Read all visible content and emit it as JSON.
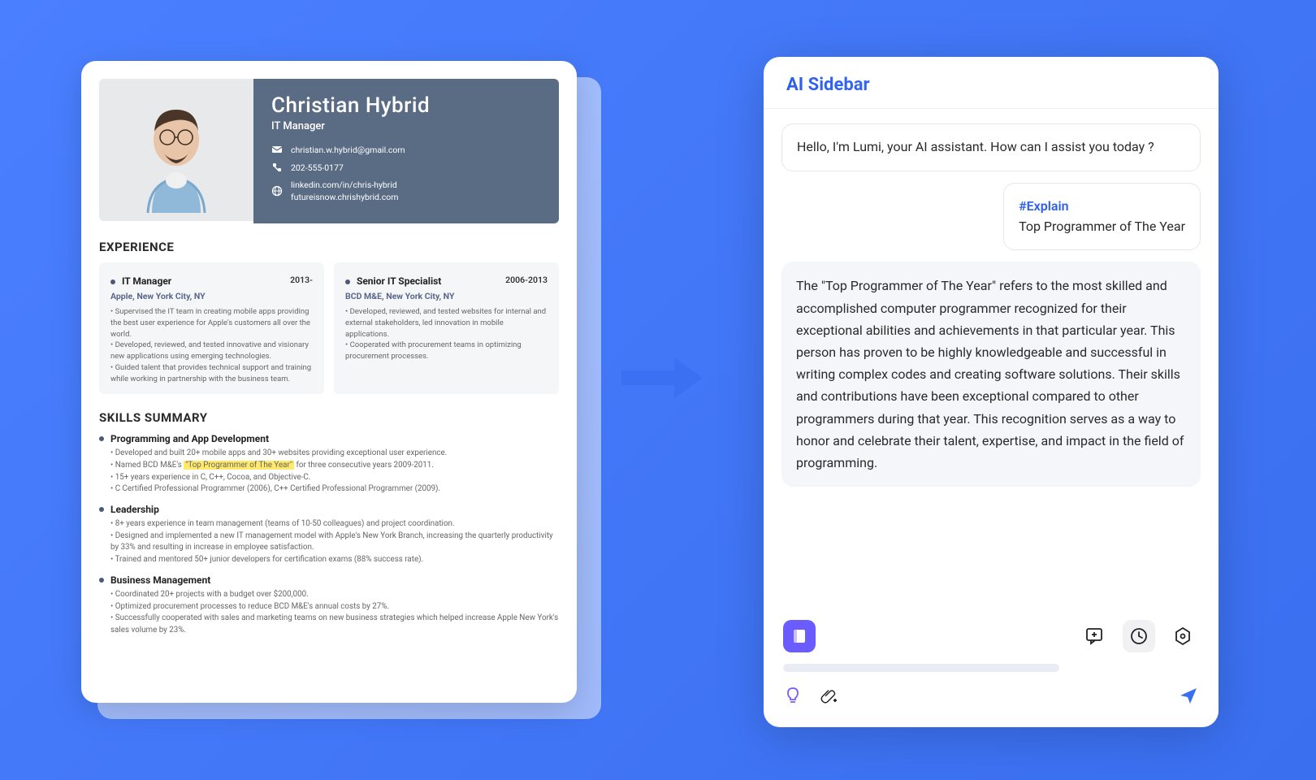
{
  "resume": {
    "name": "Christian Hybrid",
    "title": "IT Manager",
    "email": "christian.w.hybrid@gmail.com",
    "phone": "202-555-0177",
    "linkedin": "linkedin.com/in/chris-hybrid",
    "website": "futureisnow.chrishybrid.com",
    "experience_heading": "EXPERIENCE",
    "skills_heading": "SKILLS SUMMARY",
    "exp1": {
      "role": "IT Manager",
      "period": "2013-",
      "company": "Apple, New York City, NY",
      "b1": "Supervised the IT team in creating mobile apps providing the best user experience for Apple's customers all over the world.",
      "b2": "Developed, reviewed, and tested innovative and visionary new applications using emerging technologies.",
      "b3": "Guided talent that provides technical support and training while working in partnership with the business team."
    },
    "exp2": {
      "role": "Senior IT Specialist",
      "period": "2006-2013",
      "company": "BCD M&E, New York City, NY",
      "b1": "Developed, reviewed, and tested websites for internal and external stakeholders, led innovation in mobile applications.",
      "b2": "Cooperated with procurement teams in optimizing procurement processes."
    },
    "skills": {
      "s1_title": "Programming and App Development",
      "s1_b1": "Developed and built 20+ mobile apps and 30+ websites providing exceptional user experience.",
      "s1_b2a": "Named BCD M&E's ",
      "s1_b2_hl": "\"Top Programmer of The Year\"",
      "s1_b2b": " for three consecutive years 2009-2011.",
      "s1_b3": "15+ years experience in C, C++, Cocoa, and Objective-C.",
      "s1_b4": "C Certified Professional Programmer (2006), C++ Certified Professional Programmer (2009).",
      "s2_title": "Leadership",
      "s2_b1": "8+ years experience in team management (teams of 10-50 colleagues) and project coordination.",
      "s2_b2": "Designed and implemented a new IT management model with Apple's New York Branch, increasing the quarterly productivity by 33% and resulting in increase in employee satisfaction.",
      "s2_b3": "Trained and mentored 50+ junior developers for certification exams (88% success rate).",
      "s3_title": "Business Management",
      "s3_b1": "Coordinated 20+ projects with a budget over $200,000.",
      "s3_b2": "Optimized procurement processes to reduce BCD M&E's annual costs by 27%.",
      "s3_b3": "Successfully cooperated with sales and marketing teams on new business strategies which helped increase Apple New York's sales volume by 23%."
    }
  },
  "sidebar": {
    "title": "AI Sidebar",
    "greeting": "Hello, I'm Lumi, your AI assistant. How can I assist you today ?",
    "user_tag": "#Explain",
    "user_text": "Top Programmer of The Year",
    "assistant": "The \"Top Programmer of The Year\" refers to the most skilled and accomplished computer programmer recognized for their exceptional abilities and  achievements in that particular year. This person has proven to be highly knowledgeable and successful in writing complex codes and creating software solutions. Their skills and contributions have been exceptional compared to other programmers during that year. This recognition serves as a way to honor and celebrate their talent, expertise, and impact in the field of programming."
  }
}
